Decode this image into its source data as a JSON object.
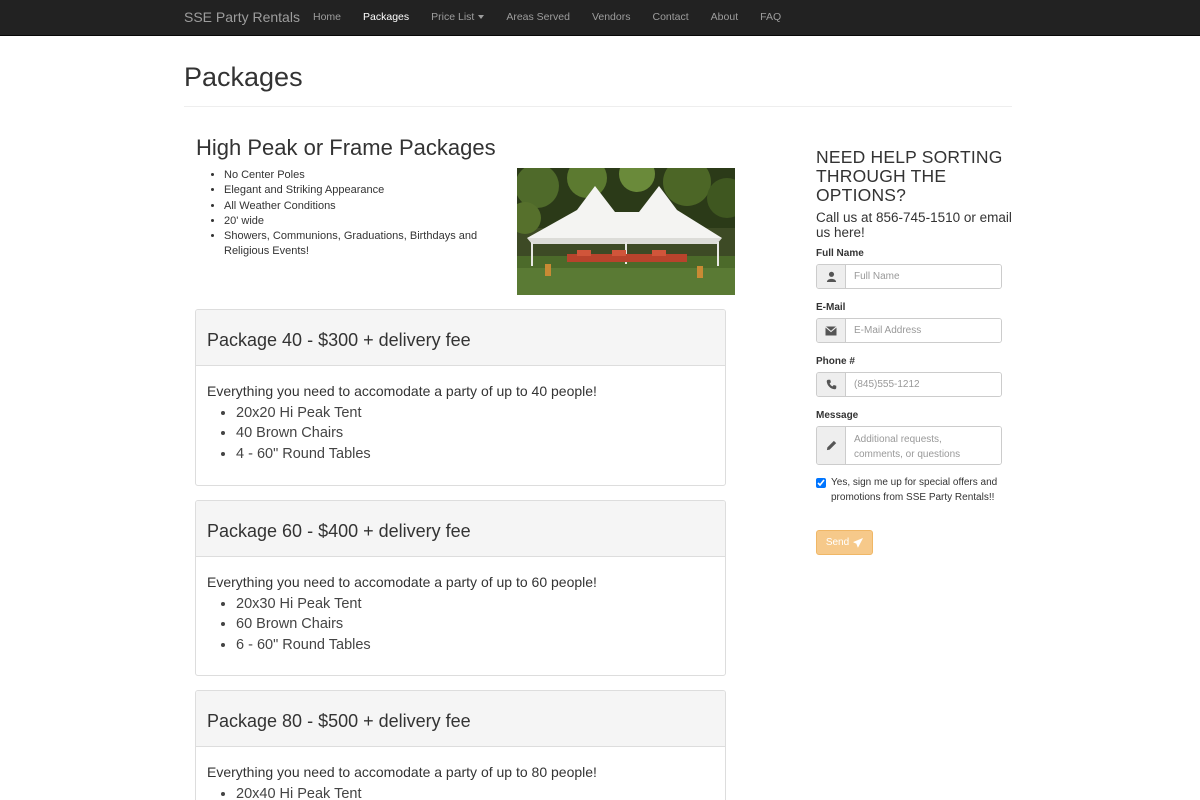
{
  "navbar": {
    "brand": "SSE Party Rentals",
    "items": [
      {
        "label": "Home"
      },
      {
        "label": "Packages",
        "active": true
      },
      {
        "label": "Price List",
        "dropdown": true
      },
      {
        "label": "Areas Served"
      },
      {
        "label": "Vendors"
      },
      {
        "label": "Contact"
      },
      {
        "label": "About"
      },
      {
        "label": "FAQ"
      }
    ]
  },
  "page": {
    "title": "Packages"
  },
  "section": {
    "title": "High Peak or Frame Packages",
    "features": [
      "No Center Poles",
      "Elegant and Striking Appearance",
      "All Weather Conditions",
      "20' wide",
      "Showers, Communions, Graduations, Birthdays and Religious Events!"
    ]
  },
  "packages": [
    {
      "title": "Package 40 - $300 + delivery fee",
      "lead": "Everything you need to accomodate a party of up to 40 people!",
      "items": [
        "20x20 Hi Peak Tent",
        "40 Brown Chairs",
        "4 - 60\" Round Tables"
      ]
    },
    {
      "title": "Package 60 - $400 + delivery fee",
      "lead": "Everything you need to accomodate a party of up to 60 people!",
      "items": [
        "20x30 Hi Peak Tent",
        "60 Brown Chairs",
        "6 - 60\" Round Tables"
      ]
    },
    {
      "title": "Package 80 - $500 + delivery fee",
      "lead": "Everything you need to accomodate a party of up to 80 people!",
      "items": [
        "20x40 Hi Peak Tent"
      ]
    }
  ],
  "contact_form": {
    "title": "NEED HELP SORTING THROUGH THE OPTIONS?",
    "subtitle": "Call us at 856-745-1510 or email us here!",
    "full_name": {
      "label": "Full Name",
      "placeholder": "Full Name",
      "value": ""
    },
    "email": {
      "label": "E-Mail",
      "placeholder": "E-Mail Address",
      "value": ""
    },
    "phone": {
      "label": "Phone #",
      "placeholder": "(845)555-1212",
      "value": ""
    },
    "message": {
      "label": "Message",
      "placeholder": "Additional requests, comments, or questions",
      "value": ""
    },
    "signup": {
      "label": "Yes, sign me up for special offers and promotions from SSE Party Rentals!!",
      "checked": true
    },
    "send_label": "Send"
  },
  "icons": {
    "name": "user-icon",
    "email": "envelope-icon",
    "phone": "phone-icon",
    "message": "pencil-icon",
    "send": "paper-plane-icon",
    "dropdown": "caret-down-icon"
  },
  "colors": {
    "navbar_bg": "#222222",
    "nav_text": "#9d9d9d",
    "nav_active": "#ffffff",
    "panel_heading_bg": "#f5f5f5",
    "send_button_bg": "#f6c98a"
  }
}
